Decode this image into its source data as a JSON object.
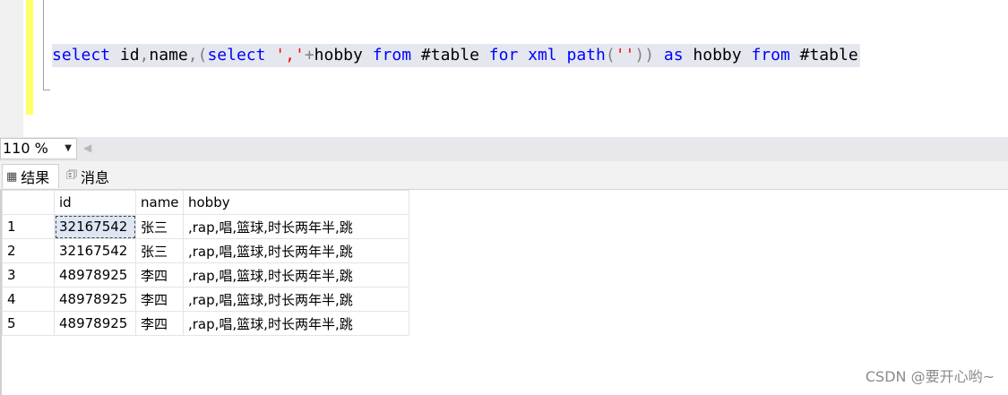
{
  "editor": {
    "tokens": [
      {
        "t": "select",
        "k": "kw"
      },
      {
        "t": " id",
        "k": "id"
      },
      {
        "t": ",",
        "k": "op"
      },
      {
        "t": "name",
        "k": "id"
      },
      {
        "t": ",(",
        "k": "op"
      },
      {
        "t": "select",
        "k": "kw"
      },
      {
        "t": " ','",
        "k": "str"
      },
      {
        "t": "+",
        "k": "op"
      },
      {
        "t": "hobby ",
        "k": "id"
      },
      {
        "t": "from",
        "k": "kw"
      },
      {
        "t": " #table ",
        "k": "id"
      },
      {
        "t": "for",
        "k": "kw"
      },
      {
        "t": " ",
        "k": "id"
      },
      {
        "t": "xml",
        "k": "kw"
      },
      {
        "t": " ",
        "k": "id"
      },
      {
        "t": "path",
        "k": "kw"
      },
      {
        "t": "(",
        "k": "op"
      },
      {
        "t": "''",
        "k": "str"
      },
      {
        "t": ")) ",
        "k": "op"
      },
      {
        "t": "as",
        "k": "kw"
      },
      {
        "t": " hobby ",
        "k": "id"
      },
      {
        "t": "from",
        "k": "kw"
      },
      {
        "t": " #table",
        "k": "id"
      }
    ]
  },
  "zoom": {
    "value": "110 %"
  },
  "tabs": {
    "results": {
      "label": "结果",
      "icon": "grid-icon"
    },
    "messages": {
      "label": "消息",
      "icon": "message-icon"
    }
  },
  "grid": {
    "columns": [
      "",
      "id",
      "name",
      "hobby"
    ],
    "rows": [
      [
        "1",
        "32167542",
        "张三",
        ",rap,唱,篮球,时长两年半,跳"
      ],
      [
        "2",
        "32167542",
        "张三",
        ",rap,唱,篮球,时长两年半,跳"
      ],
      [
        "3",
        "48978925",
        "李四",
        ",rap,唱,篮球,时长两年半,跳"
      ],
      [
        "4",
        "48978925",
        "李四",
        ",rap,唱,篮球,时长两年半,跳"
      ],
      [
        "5",
        "48978925",
        "李四",
        ",rap,唱,篮球,时长两年半,跳"
      ]
    ],
    "selected": {
      "row": 0,
      "col": 1
    }
  },
  "watermark": "CSDN @要开心哟~",
  "colors": {
    "keyword": "#0000ff",
    "string": "#ff0000",
    "operator": "#808080",
    "change_bar": "#ffff66",
    "line_highlight": "#e4e8ee"
  }
}
